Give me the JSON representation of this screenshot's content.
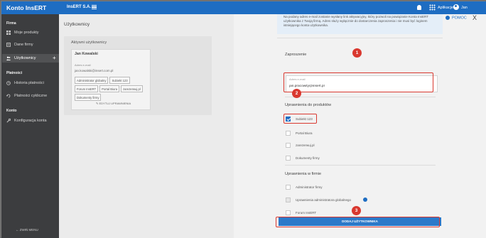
{
  "topbar": {
    "brand": "Konto InsERT",
    "company": "InsERT S.A.",
    "apps_label": "Aplikacje",
    "user_name": "Jan"
  },
  "sidebar": {
    "sections": [
      {
        "title": "Firma"
      },
      {
        "title": "Płatności"
      },
      {
        "title": "Konto"
      }
    ],
    "items": [
      {
        "label": "Moje produkty",
        "icon": "grid-icon"
      },
      {
        "label": "Dane firmy",
        "icon": "document-icon"
      },
      {
        "label": "Użytkownicy",
        "icon": "users-icon",
        "active": true
      },
      {
        "label": "Historia płatności",
        "icon": "history-icon"
      },
      {
        "label": "Płatności cykliczne",
        "icon": "recurring-payments-icon"
      },
      {
        "label": "Konfiguracja konta",
        "icon": "wrench-icon"
      }
    ],
    "collapse_label": "← ZWIŃ MENU"
  },
  "main": {
    "title": "Użytkownicy",
    "active_users_title": "Aktywni użytkownicy",
    "user": {
      "name": "Jan Kowalski",
      "email_label": "Adres e-mail",
      "email": "jan.kowalski@insert.com.pl",
      "tags": [
        "Administrator globalny",
        "Subiekt 123",
        "Forum InsERT",
        "Portal Biura",
        "zarezerwuj.pl",
        "Dokumenty firmy"
      ],
      "edit_label": "✎ EDYTUJ UPRAWNIENIA"
    }
  },
  "invite_panel": {
    "info_text": "Na podany adres e-mail zostanie wysłany link aktywacyjny, który pozwoli na powiązanie Konta InsERT użytkownika z Twoją firmą. Adres służy wyłącznie do dostarczenia zaproszenia i nie musi być loginem istniejącego konta użytkownika.",
    "help_label": "POMOC",
    "close_label": "X",
    "invite_title": "Zaproszenie",
    "email_field_label": "Adres e-mail",
    "email_value": "jan.pracowity@insert.pl",
    "products_title": "Uprawnienia do produktów",
    "products": [
      {
        "label": "Subiekt 123",
        "checked": true
      },
      {
        "label": "Portal Biura",
        "checked": false
      },
      {
        "label": "zarezerwuj.pl",
        "checked": false
      },
      {
        "label": "Dokumenty firmy",
        "checked": false
      }
    ],
    "company_perms_title": "Uprawnienia w firmie",
    "company_perms": [
      {
        "label": "Administrator firmy",
        "checked": false
      },
      {
        "label": "Uprawnienia administratora globalnego",
        "checked": false,
        "disabled": true
      },
      {
        "label": "Forum InsERT",
        "checked": false
      },
      {
        "label": "InsERT API",
        "checked": false
      }
    ],
    "add_button_label": "DODAJ UŻYTKOWNIKA"
  },
  "annotations": {
    "badge1": "1",
    "badge2": "2",
    "badge3": "3"
  },
  "colors": {
    "brand_blue": "#1e6dc2",
    "highlight_red": "#d9382f",
    "sidebar_bg": "#3c3d3f"
  }
}
